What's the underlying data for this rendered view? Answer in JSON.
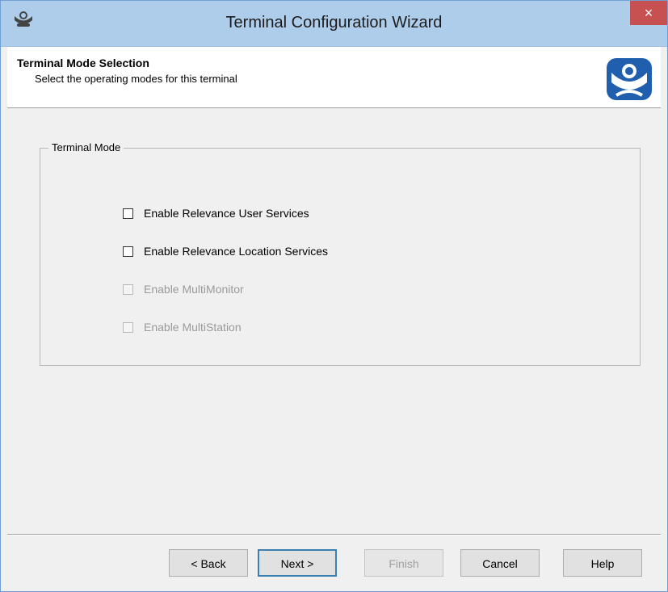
{
  "window": {
    "title": "Terminal Configuration Wizard",
    "close_label": "×"
  },
  "header": {
    "title": "Terminal Mode Selection",
    "subtitle": "Select the operating modes for this terminal"
  },
  "group": {
    "label": "Terminal Mode",
    "options": [
      {
        "label": "Enable Relevance User Services",
        "checked": false,
        "enabled": true
      },
      {
        "label": "Enable Relevance Location Services",
        "checked": false,
        "enabled": true
      },
      {
        "label": "Enable MultiMonitor",
        "checked": false,
        "enabled": false
      },
      {
        "label": "Enable MultiStation",
        "checked": false,
        "enabled": false
      }
    ]
  },
  "buttons": {
    "back": "< Back",
    "next": "Next >",
    "finish": "Finish",
    "cancel": "Cancel",
    "help": "Help"
  },
  "icons": {
    "app": "thinmanager-app-icon",
    "brand": "thinmanager-logo-icon"
  },
  "colors": {
    "titlebar": "#aecdeb",
    "close": "#c75050",
    "brand_blue": "#1f5fae"
  }
}
